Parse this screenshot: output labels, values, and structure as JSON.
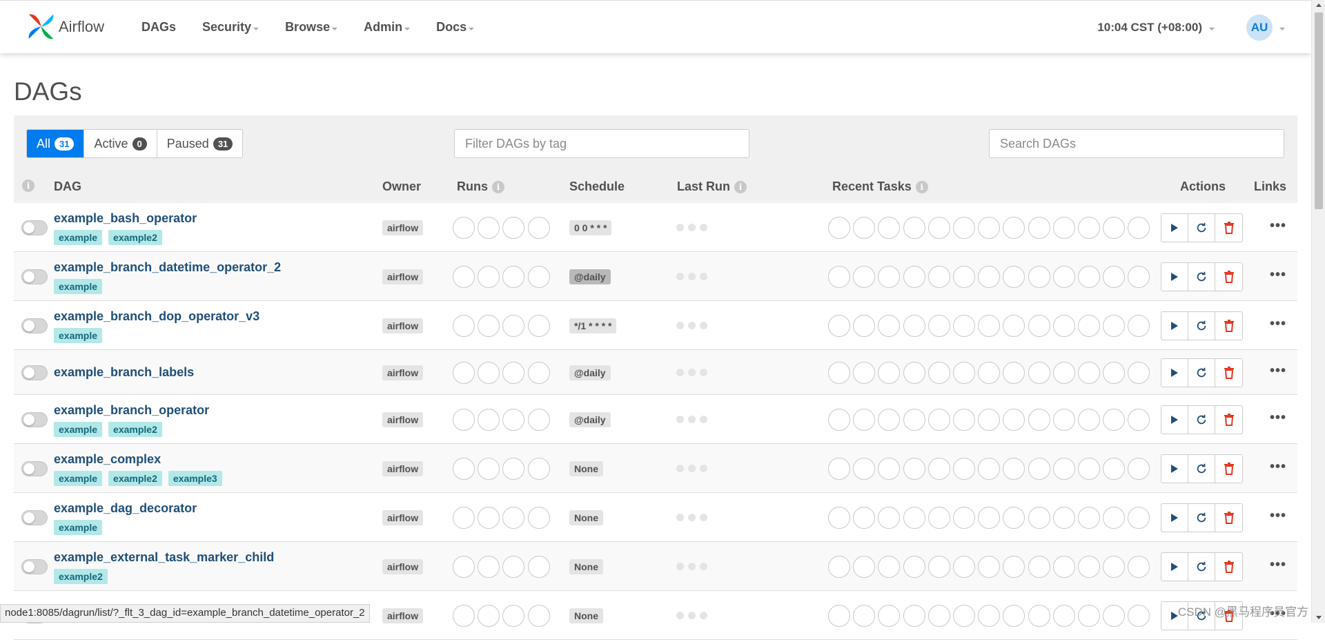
{
  "navbar": {
    "brand": "Airflow",
    "menu": [
      {
        "label": "DAGs",
        "has_caret": false
      },
      {
        "label": "Security",
        "has_caret": true
      },
      {
        "label": "Browse",
        "has_caret": true
      },
      {
        "label": "Admin",
        "has_caret": true
      },
      {
        "label": "Docs",
        "has_caret": true
      }
    ],
    "clock": "10:04 CST (+08:00)",
    "user_initials": "AU"
  },
  "page": {
    "title": "DAGs"
  },
  "filters": {
    "all_label": "All",
    "all_count": "31",
    "active_label": "Active",
    "active_count": "0",
    "paused_label": "Paused",
    "paused_count": "31",
    "tag_placeholder": "Filter DAGs by tag",
    "search_placeholder": "Search DAGs"
  },
  "table": {
    "headers": {
      "dag": "DAG",
      "owner": "Owner",
      "runs": "Runs",
      "schedule": "Schedule",
      "last_run": "Last Run",
      "recent_tasks": "Recent Tasks",
      "actions": "Actions",
      "links": "Links"
    },
    "rows": [
      {
        "dag_id": "example_bash_operator",
        "tags": [
          "example",
          "example2"
        ],
        "owner": "airflow",
        "schedule": "0 0 * * *",
        "schedule_dark": false
      },
      {
        "dag_id": "example_branch_datetime_operator_2",
        "tags": [
          "example"
        ],
        "owner": "airflow",
        "schedule": "@daily",
        "schedule_dark": true
      },
      {
        "dag_id": "example_branch_dop_operator_v3",
        "tags": [
          "example"
        ],
        "owner": "airflow",
        "schedule": "*/1 * * * *",
        "schedule_dark": false
      },
      {
        "dag_id": "example_branch_labels",
        "tags": [],
        "owner": "airflow",
        "schedule": "@daily",
        "schedule_dark": false
      },
      {
        "dag_id": "example_branch_operator",
        "tags": [
          "example",
          "example2"
        ],
        "owner": "airflow",
        "schedule": "@daily",
        "schedule_dark": false
      },
      {
        "dag_id": "example_complex",
        "tags": [
          "example",
          "example2",
          "example3"
        ],
        "owner": "airflow",
        "schedule": "None",
        "schedule_dark": false
      },
      {
        "dag_id": "example_dag_decorator",
        "tags": [
          "example"
        ],
        "owner": "airflow",
        "schedule": "None",
        "schedule_dark": false
      },
      {
        "dag_id": "example_external_task_marker_child",
        "tags": [
          "example2"
        ],
        "owner": "airflow",
        "schedule": "None",
        "schedule_dark": false
      },
      {
        "dag_id": "",
        "tags": [],
        "owner": "airflow",
        "schedule": "None",
        "schedule_dark": false
      }
    ],
    "links_glyph": "•••"
  },
  "statusbar": {
    "url": "node1:8085/dagrun/list/?_flt_3_dag_id=example_branch_datetime_operator_2"
  },
  "watermark": "CSDN @黑马程序员官方",
  "colors": {
    "primary": "#017cee",
    "tag_bg": "#b3e8e8",
    "link": "#1f4e79",
    "delete": "#e43921"
  }
}
